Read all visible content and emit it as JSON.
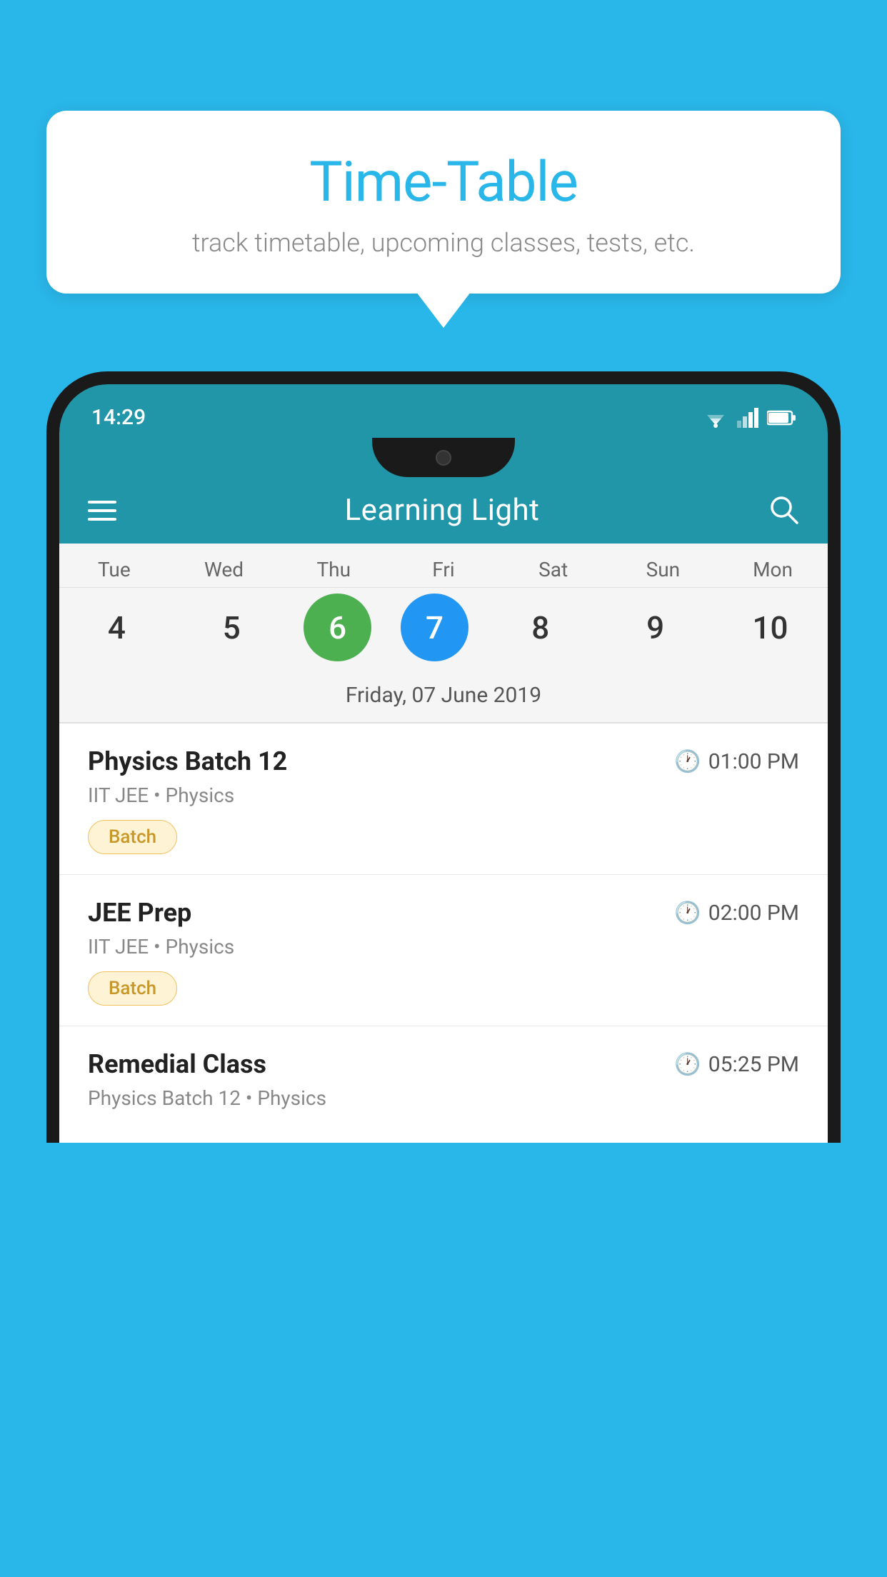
{
  "background_color": "#29b6e8",
  "bubble": {
    "title": "Time-Table",
    "subtitle": "track timetable, upcoming classes, tests, etc."
  },
  "phone": {
    "status_bar": {
      "time": "14:29"
    },
    "header": {
      "title": "Learning Light"
    },
    "calendar": {
      "days": [
        "Tue",
        "Wed",
        "Thu",
        "Fri",
        "Sat",
        "Sun",
        "Mon"
      ],
      "dates": [
        "4",
        "5",
        "6",
        "7",
        "8",
        "9",
        "10"
      ],
      "today_index": 2,
      "selected_index": 3,
      "selected_date_label": "Friday, 07 June 2019"
    },
    "schedule": [
      {
        "name": "Physics Batch 12",
        "time": "01:00 PM",
        "meta": "IIT JEE • Physics",
        "badge": "Batch"
      },
      {
        "name": "JEE Prep",
        "time": "02:00 PM",
        "meta": "IIT JEE • Physics",
        "badge": "Batch"
      },
      {
        "name": "Remedial Class",
        "time": "05:25 PM",
        "meta": "Physics Batch 12 • Physics",
        "badge": ""
      }
    ]
  }
}
